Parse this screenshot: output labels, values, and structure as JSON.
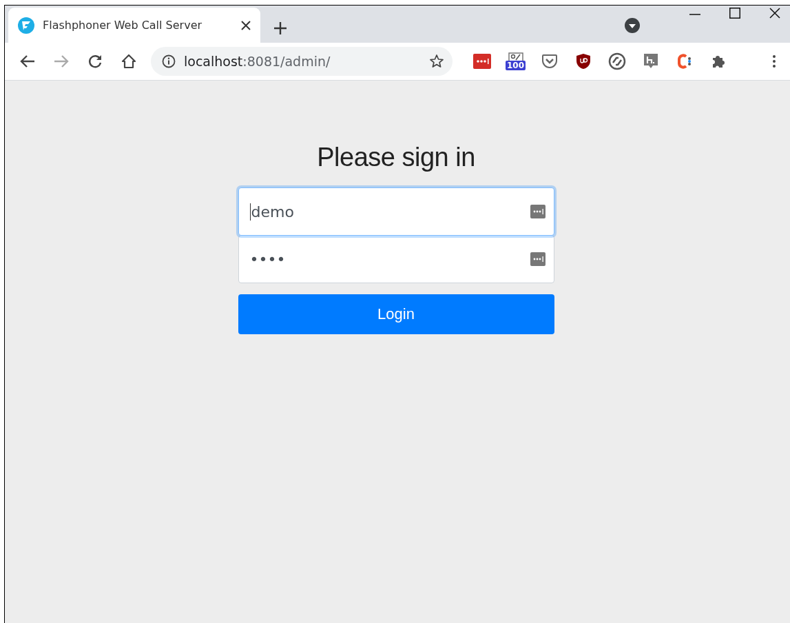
{
  "tab": {
    "title": "Flashphoner Web Call Server",
    "selected": true
  },
  "address_bar": {
    "host": "localhost",
    "path": ":8081/admin/"
  },
  "extensions": [
    {
      "kind": "passwords"
    },
    {
      "kind": "counter",
      "badge": "100"
    },
    {
      "kind": "pocket"
    },
    {
      "kind": "shield"
    },
    {
      "kind": "sync"
    },
    {
      "kind": "h"
    },
    {
      "kind": "c"
    },
    {
      "kind": "puzzle"
    }
  ],
  "login": {
    "heading": "Please sign in",
    "fields": [
      {
        "value": "demo",
        "focused": true
      },
      {
        "value": "••••",
        "focused": false
      }
    ],
    "button": "Login"
  }
}
